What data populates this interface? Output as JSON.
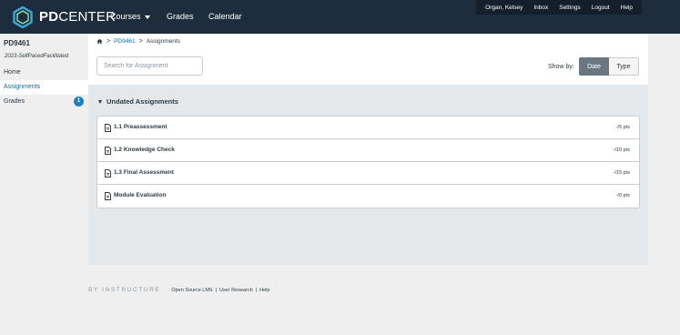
{
  "topnav": {
    "logo_text": "PDCENTER",
    "logo_text_bold": "PD",
    "logo_text_rest": "CENTER",
    "courses": "Courses",
    "grades": "Grades",
    "calendar": "Calendar",
    "user": "Organ, Kelsey",
    "inbox": "Inbox",
    "settings": "Settings",
    "logout": "Logout",
    "help": "Help"
  },
  "sidebar": {
    "course_code": "PD9461",
    "term": "2023-SelfPacedFacilitated",
    "items": [
      {
        "label": "Home"
      },
      {
        "label": "Assignments"
      },
      {
        "label": "Grades",
        "badge": "1"
      }
    ]
  },
  "breadcrumb": {
    "course": "PD9461",
    "page": "Assignments"
  },
  "search": {
    "placeholder": "Search for Assignment",
    "value": ""
  },
  "showby": {
    "label": "Show by:",
    "options": [
      "Date",
      "Type"
    ],
    "selected": "Date"
  },
  "group": {
    "title": "Undated Assignments",
    "assignments": [
      {
        "title": "1.1 Preassessment",
        "points": "-/5 pts"
      },
      {
        "title": "1.2 Knowledge Check",
        "points": "-/10 pts"
      },
      {
        "title": "1.3 Final Assessment",
        "points": "-/15 pts"
      },
      {
        "title": "Module Evaluation",
        "points": "-/0 pts"
      }
    ]
  },
  "footer": {
    "by": "BY INSTRUCTURE",
    "links": [
      "Open Source LMS",
      "User Research",
      "Help"
    ]
  },
  "colors": {
    "topnav_bg": "#1e2d3d",
    "link": "#0770a3",
    "badge": "#1a7fc8",
    "selected_segment": "#6b7780",
    "panel_bg": "#e5e8eb",
    "page_bg": "#efefef"
  }
}
